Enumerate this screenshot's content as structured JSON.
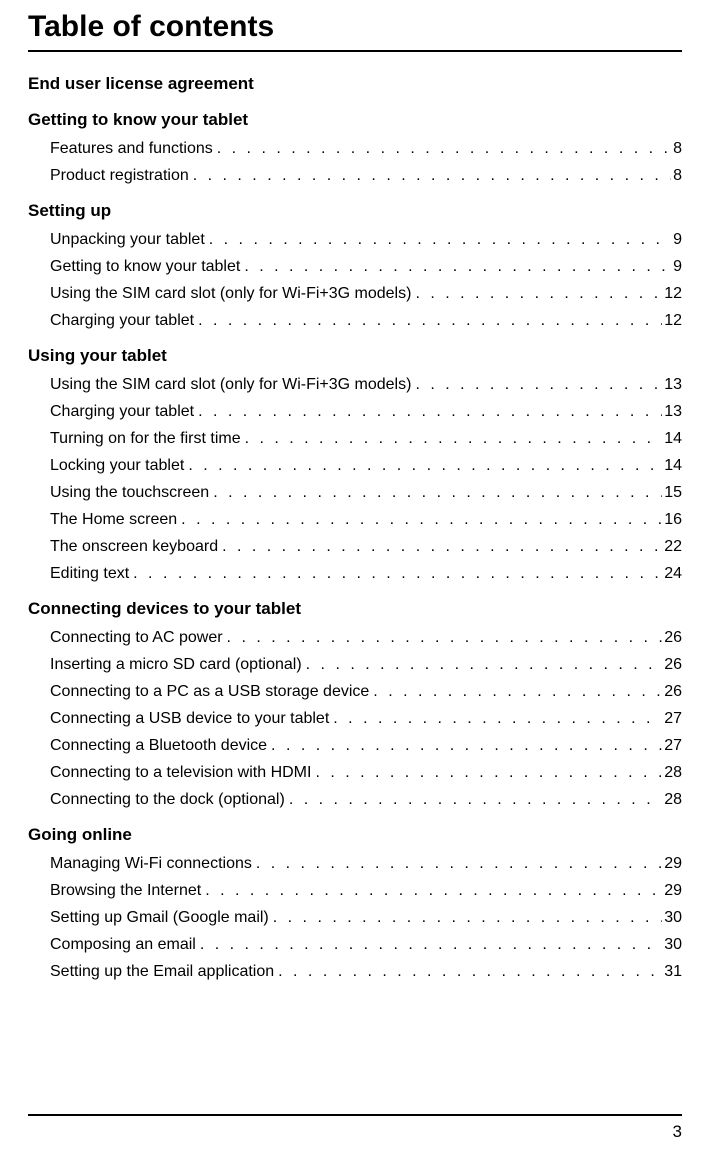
{
  "title": "Table of contents",
  "page_number": "3",
  "sections": [
    {
      "heading": "End user license agreement",
      "entries": []
    },
    {
      "heading": "Getting to know your tablet",
      "entries": [
        {
          "label": "Features and functions",
          "page": "8"
        },
        {
          "label": "Product registration",
          "page": "8"
        }
      ]
    },
    {
      "heading": "Setting up",
      "entries": [
        {
          "label": "Unpacking your tablet",
          "page": "9"
        },
        {
          "label": "Getting to know your tablet",
          "page": "9"
        },
        {
          "label": "Using the SIM card slot (only for Wi-Fi+3G models)",
          "page": "12"
        },
        {
          "label": "Charging your tablet",
          "page": "12"
        }
      ]
    },
    {
      "heading": "Using your tablet",
      "entries": [
        {
          "label": "Using the SIM card slot (only for Wi-Fi+3G models)",
          "page": "13"
        },
        {
          "label": "Charging your tablet",
          "page": "13"
        },
        {
          "label": "Turning on for the first time",
          "page": "14"
        },
        {
          "label": "Locking your tablet",
          "page": "14"
        },
        {
          "label": "Using the touchscreen",
          "page": "15"
        },
        {
          "label": "The Home screen",
          "page": "16"
        },
        {
          "label": "The onscreen keyboard",
          "page": "22"
        },
        {
          "label": "Editing text",
          "page": "24"
        }
      ]
    },
    {
      "heading": "Connecting devices to your tablet",
      "entries": [
        {
          "label": "Connecting to AC power",
          "page": "26"
        },
        {
          "label": "Inserting a micro SD card (optional)",
          "page": "26"
        },
        {
          "label": "Connecting to a PC as a USB storage device",
          "page": "26"
        },
        {
          "label": "Connecting a USB device to your tablet",
          "page": "27"
        },
        {
          "label": "Connecting a Bluetooth device",
          "page": "27"
        },
        {
          "label": "Connecting to a television with HDMI",
          "page": "28"
        },
        {
          "label": "Connecting to the dock (optional)",
          "page": "28"
        }
      ]
    },
    {
      "heading": "Going online",
      "entries": [
        {
          "label": "Managing Wi-Fi connections",
          "page": "29"
        },
        {
          "label": "Browsing the Internet",
          "page": "29"
        },
        {
          "label": "Setting up Gmail (Google mail)",
          "page": "30"
        },
        {
          "label": "Composing an email",
          "page": "30"
        },
        {
          "label": "Setting up the Email application",
          "page": "31"
        }
      ]
    }
  ]
}
